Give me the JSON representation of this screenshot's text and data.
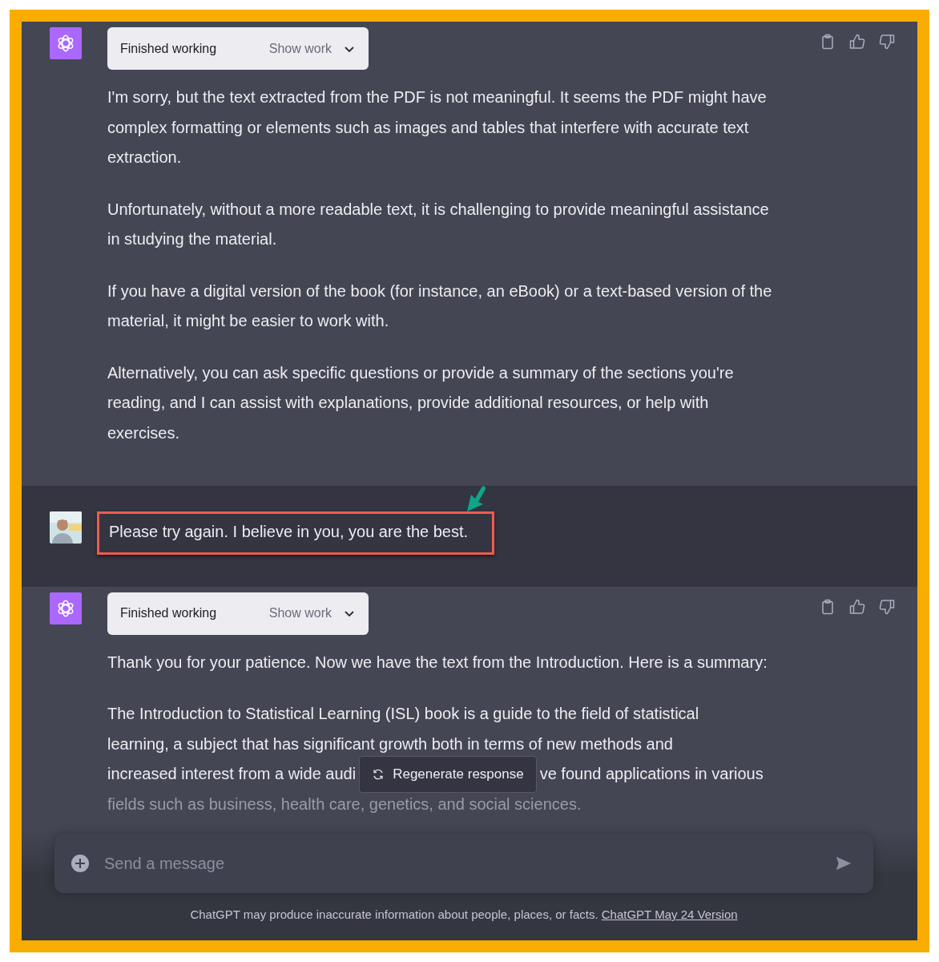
{
  "messages": [
    {
      "kind": "assistant",
      "status": "Finished working",
      "toggle": "Show work",
      "paragraphs": [
        {
          "kind": "text",
          "text": "I'm sorry, but the text extracted from the PDF is not meaningful. It seems the PDF might have complex formatting or elements such as images and tables that interfere with accurate text extraction."
        },
        {
          "kind": "text",
          "text": "Unfortunately, without a more readable text, it is challenging to provide meaningful assistance in studying the material."
        },
        {
          "kind": "text",
          "text": "If you have a digital version of the book (for instance, an eBook) or a text-based version of the material, it might be easier to work with."
        },
        {
          "kind": "text",
          "text": "Alternatively, you can ask specific questions or provide a summary of the sections you're reading, and I can assist with explanations, provide additional resources, or help with exercises."
        }
      ]
    },
    {
      "kind": "user",
      "text": "Please try again. I believe in you, you are the best.",
      "highlighted": true
    },
    {
      "kind": "assistant",
      "status": "Finished working",
      "toggle": "Show work",
      "paragraphs": [
        {
          "kind": "text",
          "text": "Thank you for your patience. Now we have the text from the Introduction. Here is a summary:"
        },
        {
          "kind": "lines",
          "lines": [
            [
              "The Introduction to Statistical Learning (ISL) book is a guide to the field of statistical"
            ],
            [
              "learning, a subject that has significant growth both in terms of new methods and"
            ],
            [
              "increased interest from a wide audi",
              "ve found applications in various"
            ],
            [
              "fields such as business, health care, genetics, and social sciences."
            ]
          ]
        }
      ]
    }
  ],
  "regenerate_button": "Regenerate response",
  "composer": {
    "placeholder": "Send a message"
  },
  "footer": {
    "text": "ChatGPT may produce inaccurate information about people, places, or facts.",
    "link": "ChatGPT May 24 Version"
  }
}
